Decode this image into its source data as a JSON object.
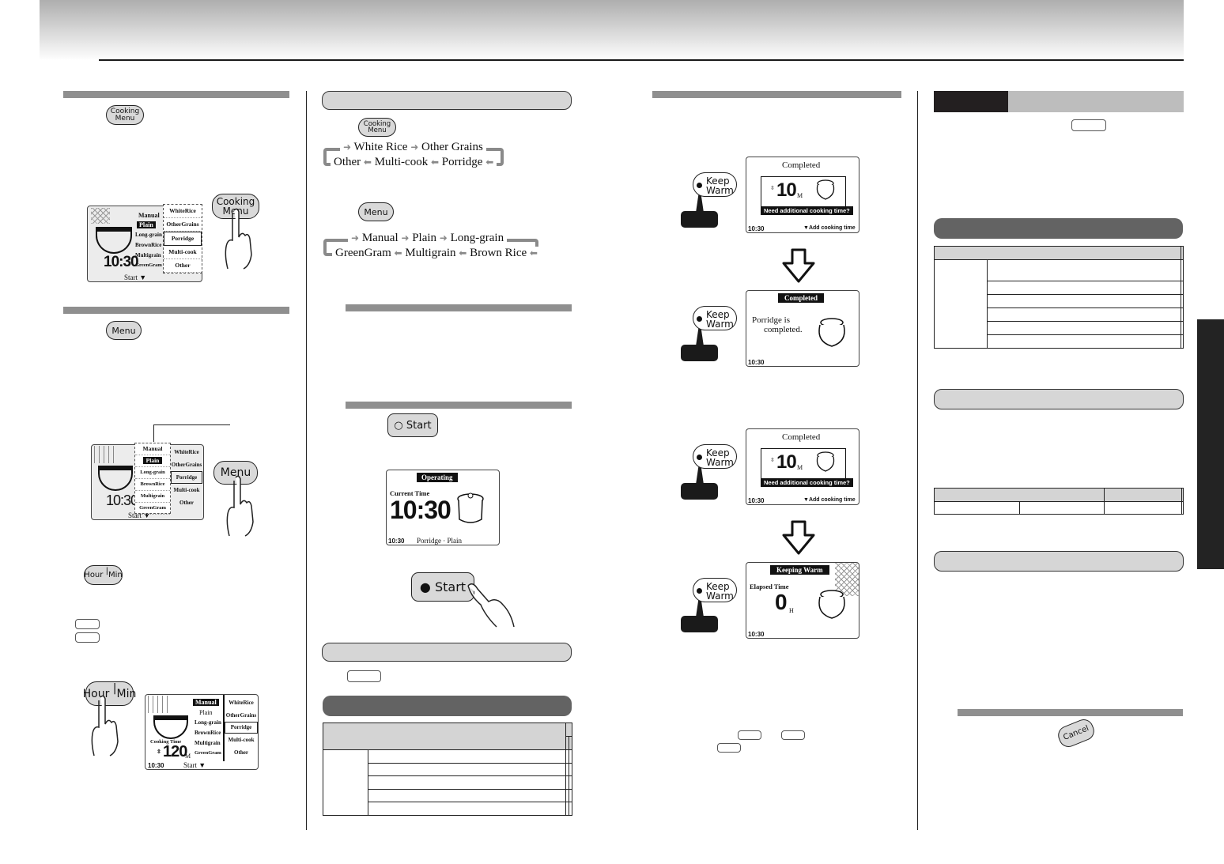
{
  "buttons": {
    "cooking_menu": "Cooking Menu",
    "cooking_menu_l1": "Cooking",
    "cooking_menu_l2": "Menu",
    "menu": "Menu",
    "hour_min_hour": "Hour",
    "hour_min_min": "Min",
    "start": "Start",
    "keep_warm_l1": "Keep",
    "keep_warm_l2": "Warm",
    "cancel": "Cancel"
  },
  "lcd_menu": {
    "left_items": [
      "Manual",
      "Plain",
      "Long-grain",
      "BrownRice",
      "Multigrain",
      "GreenGram"
    ],
    "right_items": [
      "WhiteRice",
      "OtherGrains",
      "Porridge",
      "Multi-cook",
      "Other"
    ],
    "time": "10:30",
    "start_label": "Start",
    "cooking_time_label": "Cooking Time",
    "cooking_time_value": "120",
    "cooking_time_unit": "M"
  },
  "flow_cooking_menu": {
    "row1": [
      "White Rice",
      "Other Grains"
    ],
    "row2": [
      "Other",
      "Multi-cook",
      "Porridge"
    ]
  },
  "flow_menu": {
    "row1": [
      "Manual",
      "Plain",
      "Long-grain"
    ],
    "row2": [
      "GreenGram",
      "Multigrain",
      "Brown Rice"
    ]
  },
  "lcd_operating": {
    "title": "Operating",
    "current_time_label": "Current Time",
    "time": "10:30",
    "clock": "10:30",
    "status": "Porridge · Plain"
  },
  "lcd_completed_prompt": {
    "title": "Completed",
    "value": "10",
    "unit": "M",
    "question": "Need additional cooking time?",
    "clock": "10:30",
    "hint": "Add cooking time"
  },
  "lcd_completed_msg": {
    "title": "Completed",
    "line1": "Porridge is",
    "line2": "completed.",
    "clock": "10:30"
  },
  "lcd_keeping_warm": {
    "title": "Keeping Warm",
    "elapsed_label": "Elapsed Time",
    "value": "0",
    "unit": "H",
    "clock": "10:30"
  },
  "colors": {
    "section_bar": "#8f8f8f",
    "pill_light": "#d6d6d6",
    "pill_dark": "#636363",
    "black_tab": "#232323"
  }
}
